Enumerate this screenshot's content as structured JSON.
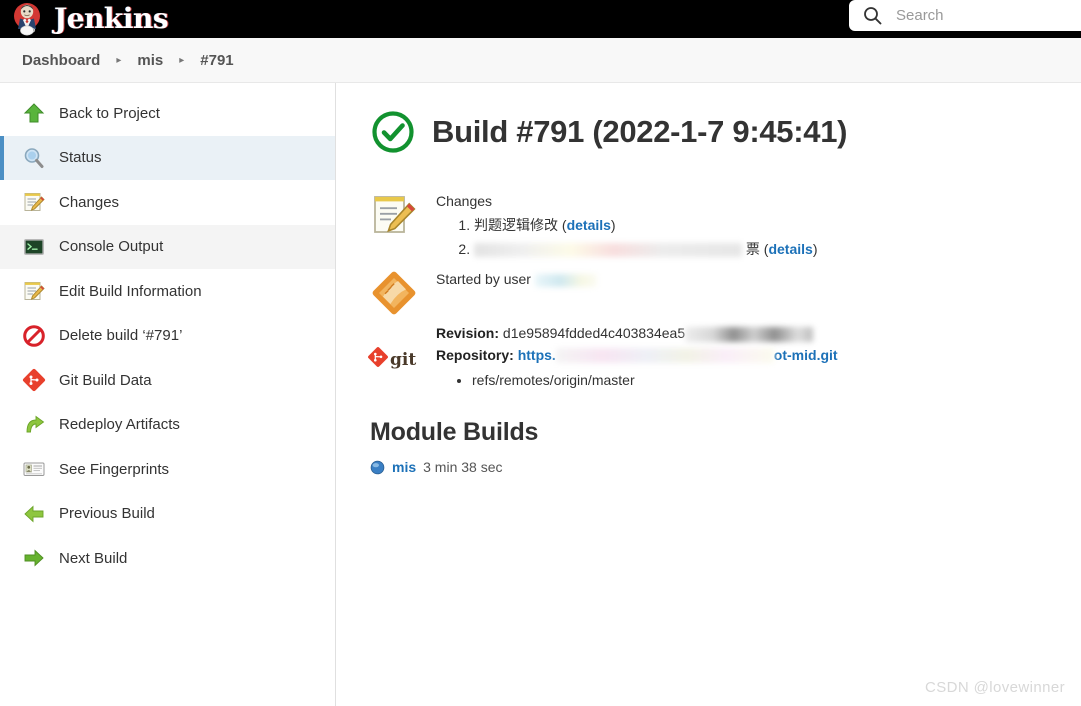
{
  "topbar": {
    "brand_name": "Jenkins",
    "brand_icon": "jenkins-butler-icon",
    "search": {
      "placeholder": "Search",
      "value": "",
      "icon": "search-icon"
    }
  },
  "breadcrumb": {
    "separator": "▸",
    "items": [
      {
        "label": "Dashboard"
      },
      {
        "label": "mis"
      },
      {
        "label": "#791"
      }
    ]
  },
  "sidebar": {
    "items": [
      {
        "label": "Back to Project",
        "icon": "up-arrow-icon",
        "state": "normal"
      },
      {
        "label": "Status",
        "icon": "magnifier-icon",
        "state": "selected"
      },
      {
        "label": "Changes",
        "icon": "notepad-pencil-icon",
        "state": "normal"
      },
      {
        "label": "Console Output",
        "icon": "terminal-icon",
        "state": "hovered"
      },
      {
        "label": "Edit Build Information",
        "icon": "notepad-pencil-icon",
        "state": "normal"
      },
      {
        "label": "Delete build ‘#791’",
        "icon": "no-entry-icon",
        "state": "normal"
      },
      {
        "label": "Git Build Data",
        "icon": "git-diamond-icon",
        "state": "normal"
      },
      {
        "label": "Redeploy Artifacts",
        "icon": "redeploy-arrow-icon",
        "state": "normal"
      },
      {
        "label": "See Fingerprints",
        "icon": "id-card-icon",
        "state": "normal"
      },
      {
        "label": "Previous Build",
        "icon": "left-arrow-icon",
        "state": "normal"
      },
      {
        "label": "Next Build",
        "icon": "right-arrow-icon",
        "state": "normal"
      }
    ]
  },
  "main": {
    "build_title": "Build #791 (2022-1-7 9:45:41)",
    "status_icon": "success-check-icon",
    "changes": {
      "icon": "notepad-pencil-icon",
      "label": "Changes",
      "items": [
        {
          "number": "1.",
          "text": "判题逻辑修改",
          "redacted": false,
          "details_label": "details"
        },
        {
          "number": "2.",
          "text": "票",
          "redacted": true,
          "details_label": "details"
        }
      ]
    },
    "started_by": {
      "icon": "orange-diamond-icon",
      "label": "Started by user",
      "user_redacted": true
    },
    "git": {
      "icon": "git-logo-icon",
      "wordmark": "git",
      "revision_label": "Revision",
      "revision_value": "d1e95894fdded4c403834ea5",
      "repository_label": "Repository",
      "repository_prefix": "https.",
      "repository_suffix": "ot-mid.git",
      "refs": [
        "refs/remotes/origin/master"
      ]
    },
    "module_builds": {
      "title": "Module Builds",
      "rows": [
        {
          "icon": "blue-ball-icon",
          "name": "mis",
          "duration": "3 min 38 sec"
        }
      ]
    }
  },
  "watermark": "CSDN @lovewinner",
  "colors": {
    "topbar_bg": "#000000",
    "breadcrumb_bg": "#f8f8f8",
    "selected_item_bg": "#eaf1f6",
    "selected_item_border": "#4b8fc4",
    "hovered_item_bg": "#f4f4f4",
    "link_blue": "#1c71b8",
    "success_green": "#12922f"
  }
}
